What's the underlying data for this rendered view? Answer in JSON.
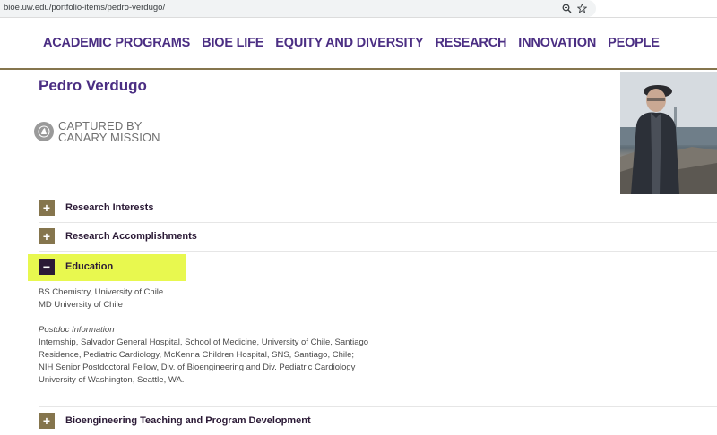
{
  "browser": {
    "url": "bioe.uw.edu/portfolio-items/pedro-verdugo/",
    "zoom_icon": "zoom-icon",
    "star_icon": "star-icon"
  },
  "nav": {
    "items": [
      "ACADEMIC PROGRAMS",
      "BIOE LIFE",
      "EQUITY AND DIVERSITY",
      "RESEARCH",
      "INNOVATION",
      "PEOPLE"
    ]
  },
  "page": {
    "title": "Pedro Verdugo"
  },
  "badge": {
    "line1": "CAPTURED BY",
    "line2": "CANARY MISSION"
  },
  "accordion": [
    {
      "label": "Research Interests",
      "state": "+"
    },
    {
      "label": "Research Accomplishments",
      "state": "+"
    },
    {
      "label": "Education",
      "state": "−"
    },
    {
      "label": "Bioengineering Teaching and Program Development",
      "state": "+"
    }
  ],
  "education": {
    "degrees": [
      "BS Chemistry, University of Chile",
      "MD University of Chile"
    ],
    "postdoc_heading": "Postdoc Information",
    "postdoc_lines": [
      "Internship, Salvador General Hospital, School of Medicine, University of Chile, Santiago",
      "Residence, Pediatric Cardiology, McKenna Children Hospital, SNS, Santiago, Chile;",
      "NIH Senior Postdoctoral Fellow, Div. of Bioengineering and Div. Pediatric Cardiology",
      "University of Washington, Seattle, WA."
    ]
  },
  "colors": {
    "uw_purple": "#4b2e83",
    "uw_gold": "#85754d",
    "highlight": "#e8f84f"
  }
}
